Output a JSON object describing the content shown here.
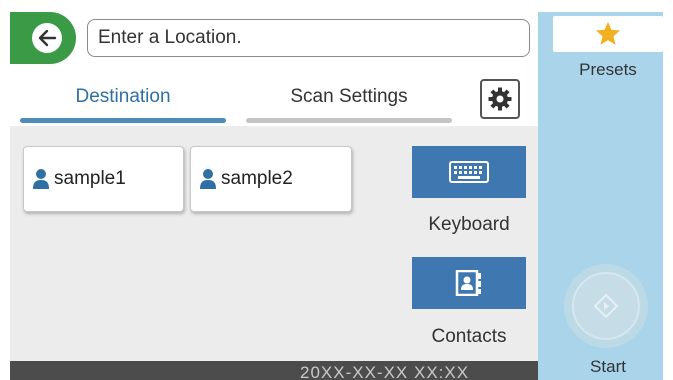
{
  "location": {
    "placeholder": "Enter a Location."
  },
  "tabs": [
    {
      "label": "Destination",
      "active": true
    },
    {
      "label": "Scan Settings",
      "active": false
    }
  ],
  "contacts": [
    {
      "name": "sample1"
    },
    {
      "name": "sample2"
    }
  ],
  "actions": {
    "keyboard_label": "Keyboard",
    "contacts_label": "Contacts"
  },
  "sidebar": {
    "presets_label": "Presets",
    "start_label": "Start"
  },
  "status": {
    "datetime": "20XX-XX-XX XX:XX"
  },
  "colors": {
    "back_green": "#3a9a46",
    "accent_blue": "#3f78b0",
    "sidebar_blue": "#a9d4ea",
    "star_gold": "#f2b020"
  }
}
